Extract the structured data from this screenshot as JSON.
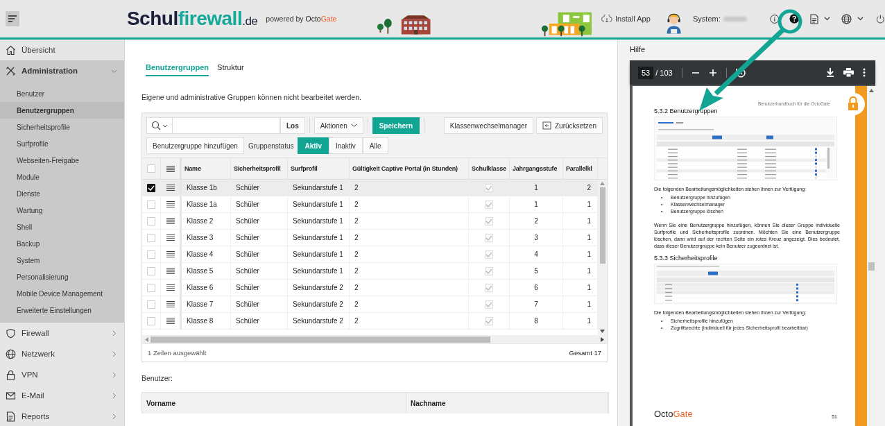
{
  "header": {
    "logo": [
      "Schul",
      "firewall",
      ".de"
    ],
    "powered_by": "powered by",
    "powered_brand": [
      "Octo",
      "Gate"
    ],
    "install_app": "Install App",
    "system_label": "System:"
  },
  "sidebar": {
    "items": [
      {
        "label": "Übersicht",
        "kind": "link"
      },
      {
        "label": "Administration",
        "kind": "group",
        "expanded": true,
        "children": [
          {
            "label": "Benutzer",
            "selected": false
          },
          {
            "label": "Benutzergruppen",
            "selected": true
          },
          {
            "label": "Sicherheitsprofile",
            "selected": false
          },
          {
            "label": "Surfprofile",
            "selected": false
          },
          {
            "label": "Webseiten-Freigabe",
            "selected": false
          },
          {
            "label": "Module",
            "selected": false
          },
          {
            "label": "Dienste",
            "selected": false
          },
          {
            "label": "Wartung",
            "selected": false
          },
          {
            "label": "Shell",
            "selected": false
          },
          {
            "label": "Backup",
            "selected": false
          },
          {
            "label": "System",
            "selected": false
          },
          {
            "label": "Personalisierung",
            "selected": false
          },
          {
            "label": "Mobile Device Management",
            "selected": false
          },
          {
            "label": "Erweiterte Einstellungen",
            "selected": false
          }
        ]
      },
      {
        "label": "Firewall",
        "kind": "group",
        "expanded": false
      },
      {
        "label": "Netzwerk",
        "kind": "group",
        "expanded": false
      },
      {
        "label": "VPN",
        "kind": "group",
        "expanded": false
      },
      {
        "label": "E-Mail",
        "kind": "group",
        "expanded": false
      },
      {
        "label": "Reports",
        "kind": "group",
        "expanded": false
      }
    ]
  },
  "tabs": [
    {
      "label": "Benutzergruppen",
      "selected": true
    },
    {
      "label": "Struktur",
      "selected": false
    }
  ],
  "notice": "Eigene und administrative Gruppen können nicht bearbeitet werden.",
  "toolbar": {
    "go": "Los",
    "actions": "Aktionen",
    "save": "Speichern",
    "class_manager": "Klassenwechselmanager",
    "reset": "Zurücksetzen",
    "add": "Benutzergruppe hinzufügen",
    "status_label": "Gruppenstatus",
    "status_options": [
      {
        "label": "Aktiv",
        "selected": true
      },
      {
        "label": "Inaktiv",
        "selected": false
      },
      {
        "label": "Alle",
        "selected": false
      }
    ]
  },
  "table": {
    "select_all_checked": false,
    "columns": [
      "Name",
      "Sicherheitsprofil",
      "Surfprofil",
      "Gültigkeit Captive Portal (in Stunden)",
      "Schulklasse",
      "Jahrgangsstufe",
      "Parallelkl"
    ],
    "rows": [
      {
        "selected": true,
        "cells": [
          "Klasse 1b",
          "Schüler",
          "Sekundarstufe 1",
          "2"
        ],
        "schulklasse": true,
        "jahrgangsstufe": "1",
        "parallelklasse": "2"
      },
      {
        "selected": false,
        "cells": [
          "Klasse 1a",
          "Schüler",
          "Sekundarstufe 1",
          "2"
        ],
        "schulklasse": true,
        "jahrgangsstufe": "1",
        "parallelklasse": "1"
      },
      {
        "selected": false,
        "cells": [
          "Klasse 2",
          "Schüler",
          "Sekundarstufe 1",
          "2"
        ],
        "schulklasse": true,
        "jahrgangsstufe": "2",
        "parallelklasse": "1"
      },
      {
        "selected": false,
        "cells": [
          "Klasse 3",
          "Schüler",
          "Sekundarstufe 1",
          "2"
        ],
        "schulklasse": true,
        "jahrgangsstufe": "3",
        "parallelklasse": "1"
      },
      {
        "selected": false,
        "cells": [
          "Klasse 4",
          "Schüler",
          "Sekundarstufe 1",
          "2"
        ],
        "schulklasse": true,
        "jahrgangsstufe": "4",
        "parallelklasse": "1"
      },
      {
        "selected": false,
        "cells": [
          "Klasse 5",
          "Schüler",
          "Sekundarstufe 1",
          "2"
        ],
        "schulklasse": true,
        "jahrgangsstufe": "5",
        "parallelklasse": "1"
      },
      {
        "selected": false,
        "cells": [
          "Klasse 6",
          "Schüler",
          "Sekundarstufe 2",
          "2"
        ],
        "schulklasse": true,
        "jahrgangsstufe": "6",
        "parallelklasse": "1"
      },
      {
        "selected": false,
        "cells": [
          "Klasse 7",
          "Schüler",
          "Sekundarstufe 2",
          "2"
        ],
        "schulklasse": true,
        "jahrgangsstufe": "7",
        "parallelklasse": "1"
      },
      {
        "selected": false,
        "cells": [
          "Klasse 8",
          "Schüler",
          "Sekundarstufe 2",
          "2"
        ],
        "schulklasse": true,
        "jahrgangsstufe": "8",
        "parallelklasse": "1"
      }
    ],
    "selected_count": "1 Zeilen ausgewählt",
    "total": "Gesamt 17"
  },
  "users": {
    "title": "Benutzer:",
    "columns": [
      "Vorname",
      "Nachname"
    ]
  },
  "help": {
    "title": "Hilfe",
    "viewer": {
      "page": "53",
      "total": "/ 103"
    },
    "document": {
      "header_note": "Benutzerhandbuch für die OctoGate",
      "heading_1": "5.3.2 Benutzergruppen",
      "intro_1": "Die folgenden Bearbeitungsmöglichkeiten stehen Ihnen zur Verfügung:",
      "bullets_1": [
        {
          "marker": "•",
          "text": "Benutzergruppe hinzufügen"
        },
        {
          "marker": "•",
          "text": "Klassenwechselmanager"
        },
        {
          "marker": "•",
          "text": "Benutzergruppe löschen"
        }
      ],
      "paragraph": "Wenn Sie eine Benutzergruppe hinzufügen, können Sie dieser Gruppe individuelle Surfprofile und Sicherheitsprofile zuordnen. Möchten Sie eine Benutzergruppe löschen, dann wird auf der rechten Seite ein rotes Kreuz angezeigt. Dies bedeutet, dass dieser Benutzergruppe kein Benutzer zugeordnet ist.",
      "heading_2": "5.3.3 Sicherheitsprofile",
      "intro_2": "Die folgenden Bearbeitungsmöglichkeiten stehen Ihnen zur Verfügung:",
      "bullets_2": [
        {
          "marker": "•",
          "text": "Sicherheitsprofile hinzufügen"
        },
        {
          "marker": "•",
          "text": "Zugriffsrechte (individuell für jedes Sicherheitsprofil bearbeitbar)"
        }
      ],
      "logo": [
        "Octo",
        "Gate"
      ],
      "page_number": "51"
    }
  }
}
